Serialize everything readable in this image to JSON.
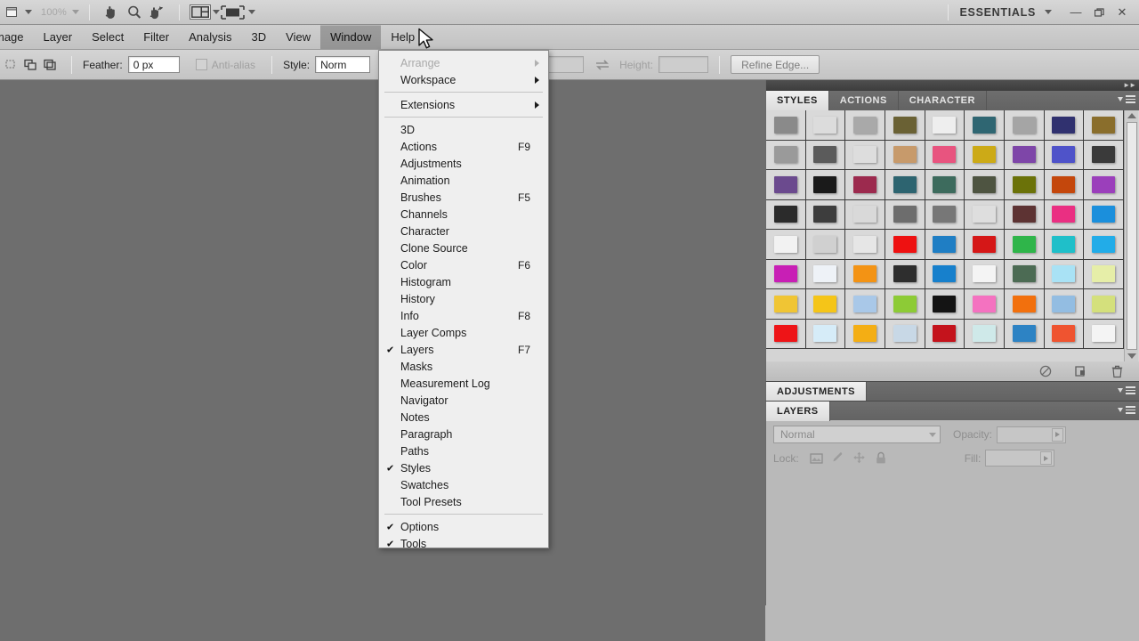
{
  "appbar": {
    "doc_arrange_icon": "arrange-documents-icon",
    "zoom_level": "100%",
    "tools": [
      {
        "name": "hand-tool-icon"
      },
      {
        "name": "zoom-tool-icon"
      },
      {
        "name": "rotate-view-tool-icon"
      }
    ],
    "screen_mode_icon": "screen-mode-icon",
    "view_extras_icon": "view-extras-icon",
    "workspace_label": "ESSENTIALS",
    "window_controls": {
      "minimize": "—",
      "restore": "❐",
      "close": "✕"
    }
  },
  "menubar": {
    "items": [
      {
        "label": "mage",
        "active": false,
        "clipped": true
      },
      {
        "label": "Layer",
        "active": false
      },
      {
        "label": "Select",
        "active": false
      },
      {
        "label": "Filter",
        "active": false
      },
      {
        "label": "Analysis",
        "active": false
      },
      {
        "label": "3D",
        "active": false
      },
      {
        "label": "View",
        "active": false
      },
      {
        "label": "Window",
        "active": true
      },
      {
        "label": "Help",
        "active": false
      }
    ]
  },
  "optionsbar": {
    "selection_modes": [
      "new-selection-icon",
      "add-to-selection-icon",
      "subtract-from-selection-icon",
      "intersect-selection-icon"
    ],
    "feather_label": "Feather:",
    "feather_value": "0 px",
    "antialias_label": "Anti-alias",
    "antialias_checked": false,
    "style_label": "Style:",
    "style_value": "Norm",
    "width_value": "",
    "swap_icon": "swap-width-height-icon",
    "height_label": "Height:",
    "height_value": "",
    "refine_edge_label": "Refine Edge..."
  },
  "window_menu": {
    "rows": [
      {
        "label": "Arrange",
        "dim": true,
        "submenu": true
      },
      {
        "label": "Workspace",
        "submenu": true
      },
      {
        "sep": true
      },
      {
        "label": "Extensions",
        "submenu": true
      },
      {
        "sep": true
      },
      {
        "label": "3D"
      },
      {
        "label": "Actions",
        "shortcut": "F9"
      },
      {
        "label": "Adjustments"
      },
      {
        "label": "Animation"
      },
      {
        "label": "Brushes",
        "shortcut": "F5"
      },
      {
        "label": "Channels"
      },
      {
        "label": "Character"
      },
      {
        "label": "Clone Source"
      },
      {
        "label": "Color",
        "shortcut": "F6"
      },
      {
        "label": "Histogram"
      },
      {
        "label": "History"
      },
      {
        "label": "Info",
        "shortcut": "F8"
      },
      {
        "label": "Layer Comps"
      },
      {
        "label": "Layers",
        "shortcut": "F7",
        "checked": true
      },
      {
        "label": "Masks"
      },
      {
        "label": "Measurement Log"
      },
      {
        "label": "Navigator"
      },
      {
        "label": "Notes"
      },
      {
        "label": "Paragraph"
      },
      {
        "label": "Paths"
      },
      {
        "label": "Styles",
        "checked": true
      },
      {
        "label": "Swatches"
      },
      {
        "label": "Tool Presets"
      },
      {
        "sep": true
      },
      {
        "label": "Options",
        "checked": true
      },
      {
        "label": "Tools",
        "checked": true
      }
    ]
  },
  "dock": {
    "styles_panel": {
      "tabs": [
        {
          "label": "STYLES",
          "active": true
        },
        {
          "label": "ACTIONS",
          "active": false
        },
        {
          "label": "CHARACTER",
          "active": false
        }
      ],
      "swatches": [
        "#8a8a8a",
        "#dcdcdc",
        "#a9a9a9",
        "#6a6134",
        "#eeeeee",
        "#2f6672",
        "#a5a5a5",
        "#30316f",
        "#8a6e2c",
        "#9a9a9a",
        "#5b5b5b",
        "#dddddd",
        "#c79a6b",
        "#e8547f",
        "#ccaa17",
        "#7e46a8",
        "#4f53c9",
        "#3a3a3a",
        "#6b4a8e",
        "#1a1a1a",
        "#9c2a4e",
        "#2d6470",
        "#3d6b5d",
        "#4e5441",
        "#6b7209",
        "#c4470c",
        "#9b3fbb",
        "#2b2b2b",
        "#3d3d3d",
        "#d9d9d9",
        "#6d6d6d",
        "#777777",
        "#dedede",
        "#5d3333",
        "#ea2f82",
        "#1b8fdc",
        "#f2f2f2",
        "#d0d0d0",
        "#e6e6e6",
        "#ee1111",
        "#1f7ec4",
        "#d51717",
        "#2fb54a",
        "#1fbfc9",
        "#22ace8",
        "#c81fb5",
        "#eef2f7",
        "#f39314",
        "#2e2e2e",
        "#1780cc",
        "#f4f4f4",
        "#4c6b54",
        "#a9e2f5",
        "#e6eea8",
        "#f0c534",
        "#f5c518",
        "#a9c8e8",
        "#8dcb36",
        "#141414",
        "#f472c0",
        "#f2700d",
        "#93bde2",
        "#d4e07c",
        "#ee1417",
        "#d6ecf8",
        "#f4ae14",
        "#c8d8e6",
        "#c4131c",
        "#cfe9e9",
        "#2d83c4",
        "#ef5430",
        "#f4f4f4"
      ],
      "footer_icons": [
        "clear-style-icon",
        "new-style-icon",
        "delete-style-icon"
      ]
    },
    "adjustments_panel": {
      "title": "ADJUSTMENTS"
    },
    "layers_panel": {
      "title": "LAYERS",
      "blend_mode": "Normal",
      "opacity_label": "Opacity:",
      "opacity_value": "",
      "lock_label": "Lock:",
      "lock_icons": [
        "lock-transparent-pixels-icon",
        "lock-image-pixels-icon",
        "lock-position-icon",
        "lock-all-icon"
      ],
      "fill_label": "Fill:",
      "fill_value": ""
    }
  }
}
